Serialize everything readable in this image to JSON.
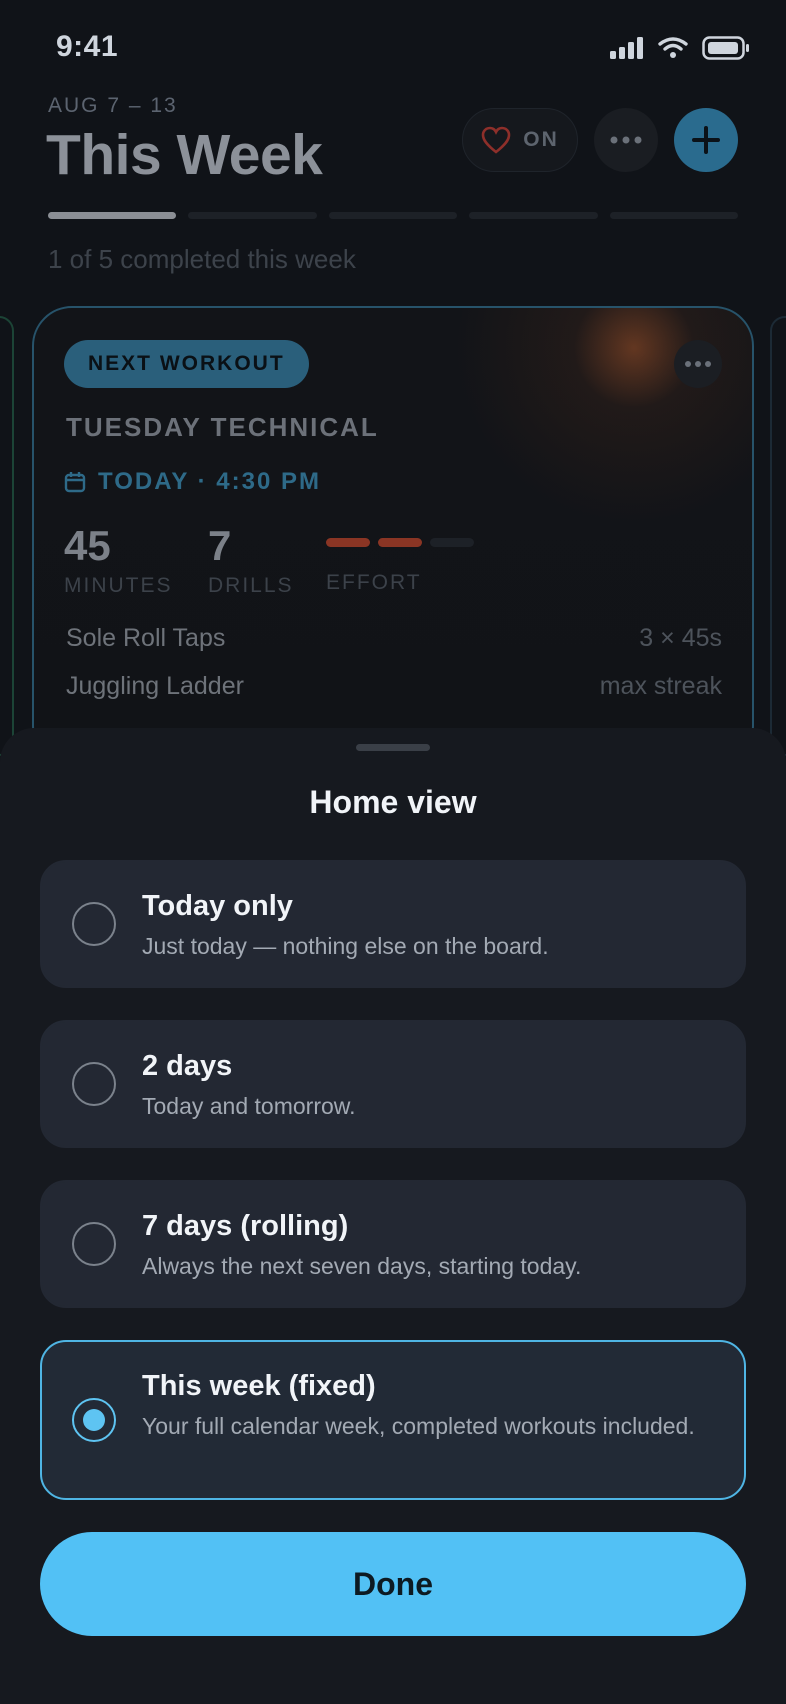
{
  "status_bar": {
    "time": "9:41"
  },
  "header": {
    "date_range": "AUG 7 – 13",
    "title": "This Week",
    "heart_toggle_label": "ON",
    "progress_total": 5,
    "progress_done": 1,
    "completed_text": "1 of 5 completed this week"
  },
  "card": {
    "badge": "NEXT WORKOUT",
    "name": "TUESDAY TECHNICAL",
    "when": "TODAY · 4:30 PM",
    "stats": [
      {
        "value": "45",
        "label": "MINUTES"
      },
      {
        "value": "7",
        "label": "DRILLS"
      }
    ],
    "effort": {
      "label": "EFFORT",
      "level": 2,
      "max": 3
    },
    "drills": [
      {
        "name": "Sole Roll Taps",
        "value": "3 × 45s"
      },
      {
        "name": "Juggling Ladder",
        "value": "max streak"
      }
    ]
  },
  "sheet": {
    "title": "Home view",
    "options": [
      {
        "title": "Today only",
        "desc": "Just today — nothing else on the board.",
        "selected": false
      },
      {
        "title": "2 days",
        "desc": "Today and tomorrow.",
        "selected": false
      },
      {
        "title": "7 days (rolling)",
        "desc": "Always the next seven days, starting today.",
        "selected": false
      },
      {
        "title": "This week (fixed)",
        "desc": "Your full calendar week, completed workouts included.",
        "selected": true
      }
    ],
    "done_label": "Done"
  },
  "colors": {
    "accent": "#52c1f5",
    "effort": "#8a3524",
    "card_border": "#27536a"
  }
}
